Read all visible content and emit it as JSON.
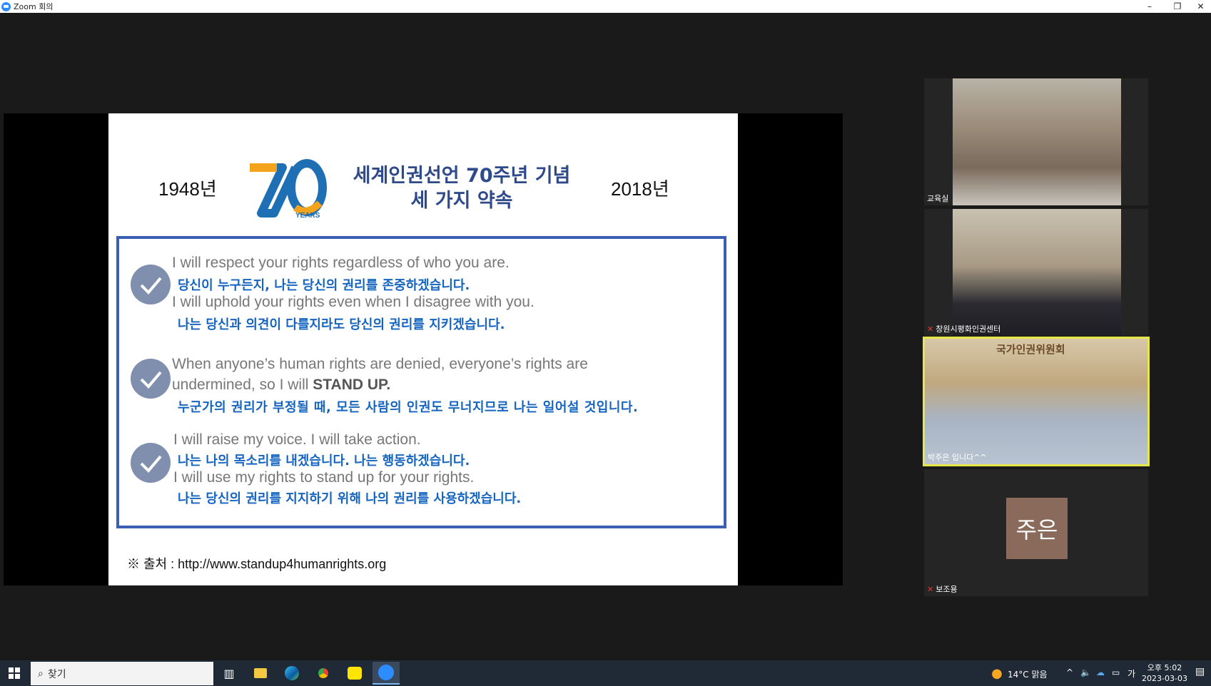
{
  "window": {
    "title": "Zoom 회의",
    "minimize": "–",
    "maximize": "❐",
    "close": "✕"
  },
  "slide": {
    "year_left": "1948년",
    "year_right": "2018년",
    "logo_number": "70",
    "logo_sub": "YEARS",
    "title_line1": "세계인권선언 70주년 기념",
    "title_line2": "세 가지 약속",
    "promises": [
      {
        "en1": "I will respect your rights regardless of who you are.",
        "ko1": "당신이 누구든지, 나는 당신의 권리를 존중하겠습니다.",
        "en2": "I will uphold your rights even when I disagree with you.",
        "ko2": "나는 당신과 의견이 다를지라도 당신의 권리를 지키겠습니다."
      },
      {
        "en1": "When anyone’s human rights are denied, everyone’s rights are",
        "en2_pre": "undermined, so I will ",
        "en2_bold": "STAND UP.",
        "ko1": "누군가의 권리가 부정될 때, 모든 사람의 인권도 무너지므로 나는 일어설 것입니다."
      },
      {
        "en1": "I will raise my voice. I will take action.",
        "ko1": "나는 나의 목소리를 내겠습니다. 나는 행동하겠습니다.",
        "en2": "I will use my rights to stand up for your rights.",
        "ko2": "나는 당신의 권리를 지지하기 위해 나의 권리를 사용하겠습니다."
      }
    ],
    "source": "※ 출처 : http://www.standup4humanrights.org"
  },
  "participants": [
    {
      "name": "교육실",
      "muted": false
    },
    {
      "name": "창원시평화인권센터",
      "muted": true
    },
    {
      "name": "박주은 입니다^^",
      "muted": false,
      "active_speaker": true,
      "sign_text": "국가인권위원회"
    },
    {
      "name": "보조용",
      "muted": true,
      "avatar_text": "주은"
    }
  ],
  "taskbar": {
    "search_placeholder": "찾기",
    "weather": "14°C 맑음",
    "ime": "가",
    "time": "오후 5:02",
    "date": "2023-03-03"
  },
  "colors": {
    "active_speaker_border": "#e6e64a",
    "slide_title": "#2e4a8a",
    "korean_text": "#1565c0",
    "box_border": "#3b5fb5"
  }
}
